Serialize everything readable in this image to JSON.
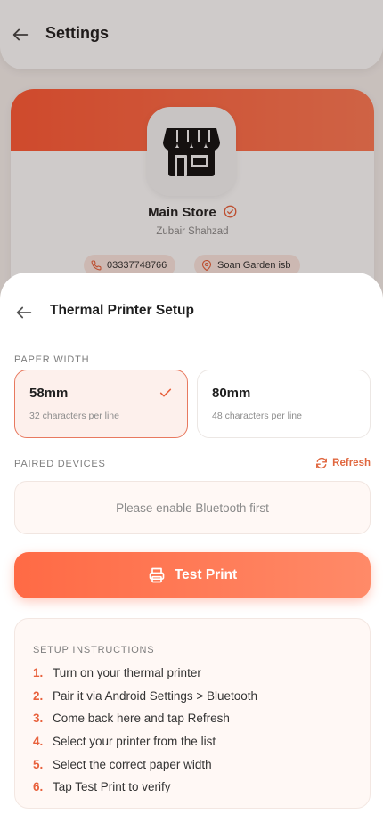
{
  "background_page": {
    "title": "Settings",
    "store": {
      "name": "Main Store",
      "owner": "Zubair Shahzad",
      "phone": "03337748766",
      "location": "Soan Garden isb"
    }
  },
  "sheet": {
    "title": "Thermal Printer Setup",
    "paper_width": {
      "label": "PAPER WIDTH",
      "options": [
        {
          "title": "58mm",
          "subtitle": "32 characters per line",
          "selected": true
        },
        {
          "title": "80mm",
          "subtitle": "48 characters per line",
          "selected": false
        }
      ]
    },
    "paired_devices": {
      "label": "PAIRED DEVICES",
      "refresh_label": "Refresh",
      "empty_message": "Please enable Bluetooth first"
    },
    "test_print_label": "Test Print",
    "instructions": {
      "title": "SETUP INSTRUCTIONS",
      "steps": [
        {
          "num": "1.",
          "text": "Turn on your thermal printer"
        },
        {
          "num": "2.",
          "text": "Pair it via Android Settings > Bluetooth"
        },
        {
          "num": "3.",
          "text": "Come back here and tap Refresh"
        },
        {
          "num": "4.",
          "text": "Select your printer from the list"
        },
        {
          "num": "5.",
          "text": "Select the correct paper width"
        },
        {
          "num": "6.",
          "text": "Tap Test Print to verify"
        }
      ]
    }
  },
  "colors": {
    "accent": "#e8613c",
    "accent_light": "#fdf0ec",
    "button_gradient_start": "#ff6a45",
    "button_gradient_end": "#ff8a68"
  },
  "icons": {
    "back": "arrow-left-icon",
    "store": "storefront-icon",
    "verified": "verified-check-icon",
    "phone": "phone-icon",
    "location": "map-pin-icon",
    "check": "check-icon",
    "refresh": "refresh-icon",
    "printer": "printer-icon"
  }
}
